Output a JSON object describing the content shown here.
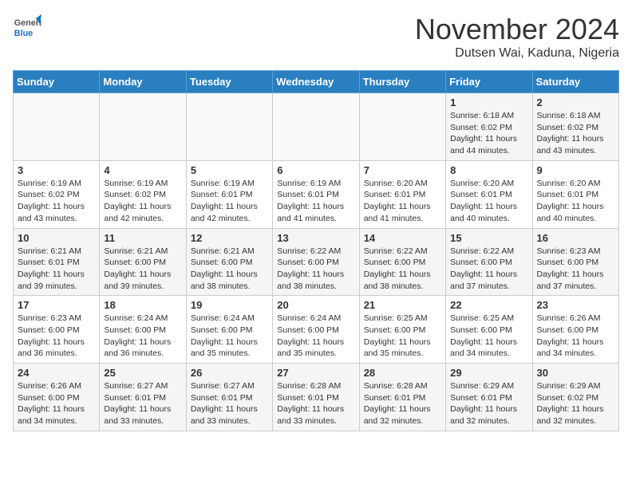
{
  "header": {
    "logo_general": "General",
    "logo_blue": "Blue",
    "month_title": "November 2024",
    "location": "Dutsen Wai, Kaduna, Nigeria"
  },
  "weekdays": [
    "Sunday",
    "Monday",
    "Tuesday",
    "Wednesday",
    "Thursday",
    "Friday",
    "Saturday"
  ],
  "weeks": [
    [
      {
        "day": "",
        "info": ""
      },
      {
        "day": "",
        "info": ""
      },
      {
        "day": "",
        "info": ""
      },
      {
        "day": "",
        "info": ""
      },
      {
        "day": "",
        "info": ""
      },
      {
        "day": "1",
        "info": "Sunrise: 6:18 AM\nSunset: 6:02 PM\nDaylight: 11 hours\nand 44 minutes."
      },
      {
        "day": "2",
        "info": "Sunrise: 6:18 AM\nSunset: 6:02 PM\nDaylight: 11 hours\nand 43 minutes."
      }
    ],
    [
      {
        "day": "3",
        "info": "Sunrise: 6:19 AM\nSunset: 6:02 PM\nDaylight: 11 hours\nand 43 minutes."
      },
      {
        "day": "4",
        "info": "Sunrise: 6:19 AM\nSunset: 6:02 PM\nDaylight: 11 hours\nand 42 minutes."
      },
      {
        "day": "5",
        "info": "Sunrise: 6:19 AM\nSunset: 6:01 PM\nDaylight: 11 hours\nand 42 minutes."
      },
      {
        "day": "6",
        "info": "Sunrise: 6:19 AM\nSunset: 6:01 PM\nDaylight: 11 hours\nand 41 minutes."
      },
      {
        "day": "7",
        "info": "Sunrise: 6:20 AM\nSunset: 6:01 PM\nDaylight: 11 hours\nand 41 minutes."
      },
      {
        "day": "8",
        "info": "Sunrise: 6:20 AM\nSunset: 6:01 PM\nDaylight: 11 hours\nand 40 minutes."
      },
      {
        "day": "9",
        "info": "Sunrise: 6:20 AM\nSunset: 6:01 PM\nDaylight: 11 hours\nand 40 minutes."
      }
    ],
    [
      {
        "day": "10",
        "info": "Sunrise: 6:21 AM\nSunset: 6:01 PM\nDaylight: 11 hours\nand 39 minutes."
      },
      {
        "day": "11",
        "info": "Sunrise: 6:21 AM\nSunset: 6:00 PM\nDaylight: 11 hours\nand 39 minutes."
      },
      {
        "day": "12",
        "info": "Sunrise: 6:21 AM\nSunset: 6:00 PM\nDaylight: 11 hours\nand 38 minutes."
      },
      {
        "day": "13",
        "info": "Sunrise: 6:22 AM\nSunset: 6:00 PM\nDaylight: 11 hours\nand 38 minutes."
      },
      {
        "day": "14",
        "info": "Sunrise: 6:22 AM\nSunset: 6:00 PM\nDaylight: 11 hours\nand 38 minutes."
      },
      {
        "day": "15",
        "info": "Sunrise: 6:22 AM\nSunset: 6:00 PM\nDaylight: 11 hours\nand 37 minutes."
      },
      {
        "day": "16",
        "info": "Sunrise: 6:23 AM\nSunset: 6:00 PM\nDaylight: 11 hours\nand 37 minutes."
      }
    ],
    [
      {
        "day": "17",
        "info": "Sunrise: 6:23 AM\nSunset: 6:00 PM\nDaylight: 11 hours\nand 36 minutes."
      },
      {
        "day": "18",
        "info": "Sunrise: 6:24 AM\nSunset: 6:00 PM\nDaylight: 11 hours\nand 36 minutes."
      },
      {
        "day": "19",
        "info": "Sunrise: 6:24 AM\nSunset: 6:00 PM\nDaylight: 11 hours\nand 35 minutes."
      },
      {
        "day": "20",
        "info": "Sunrise: 6:24 AM\nSunset: 6:00 PM\nDaylight: 11 hours\nand 35 minutes."
      },
      {
        "day": "21",
        "info": "Sunrise: 6:25 AM\nSunset: 6:00 PM\nDaylight: 11 hours\nand 35 minutes."
      },
      {
        "day": "22",
        "info": "Sunrise: 6:25 AM\nSunset: 6:00 PM\nDaylight: 11 hours\nand 34 minutes."
      },
      {
        "day": "23",
        "info": "Sunrise: 6:26 AM\nSunset: 6:00 PM\nDaylight: 11 hours\nand 34 minutes."
      }
    ],
    [
      {
        "day": "24",
        "info": "Sunrise: 6:26 AM\nSunset: 6:00 PM\nDaylight: 11 hours\nand 34 minutes."
      },
      {
        "day": "25",
        "info": "Sunrise: 6:27 AM\nSunset: 6:01 PM\nDaylight: 11 hours\nand 33 minutes."
      },
      {
        "day": "26",
        "info": "Sunrise: 6:27 AM\nSunset: 6:01 PM\nDaylight: 11 hours\nand 33 minutes."
      },
      {
        "day": "27",
        "info": "Sunrise: 6:28 AM\nSunset: 6:01 PM\nDaylight: 11 hours\nand 33 minutes."
      },
      {
        "day": "28",
        "info": "Sunrise: 6:28 AM\nSunset: 6:01 PM\nDaylight: 11 hours\nand 32 minutes."
      },
      {
        "day": "29",
        "info": "Sunrise: 6:29 AM\nSunset: 6:01 PM\nDaylight: 11 hours\nand 32 minutes."
      },
      {
        "day": "30",
        "info": "Sunrise: 6:29 AM\nSunset: 6:02 PM\nDaylight: 11 hours\nand 32 minutes."
      }
    ]
  ]
}
